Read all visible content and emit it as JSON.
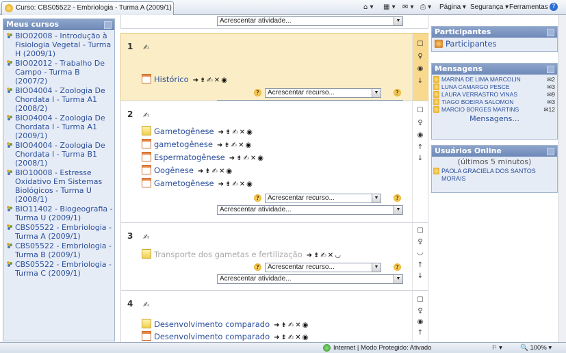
{
  "browser": {
    "tab_title": "Curso: CBS05522 - Embriologia - Turma A (2009/1)",
    "menu": {
      "page": "Página",
      "security": "Segurança",
      "tools": "Ferramentas"
    }
  },
  "left_block": {
    "title": "Meus cursos",
    "courses": [
      "BIO02008 - Introdução à Fisiologia Vegetal - Turma H (2009/1)",
      "BIO02012 - Trabalho De Campo - Turma B (2007/2)",
      "BIO04004 - Zoologia De Chordata I - Turma A1 (2008/2)",
      "BIO04004 - Zoologia De Chordata I - Turma A1 (2009/1)",
      "BIO04004 - Zoologia De Chordata I - Turma B1 (2008/1)",
      "BIO10008 - Estresse Oxidativo Em Sistemas Biológicos - Turma U (2008/1)",
      "BIO11402 - Biogeografia - Turma U (2009/1)",
      "CBS05522 - Embriologia - Turma A (2009/1)",
      "CBS05522 - Embriologia - Turma B (2009/1)",
      "CBS05522 - Embriologia - Turma C (2009/1)"
    ]
  },
  "main": {
    "top_activity_select": "Acrescentar atividade...",
    "add_resource": "Acrescentar recurso...",
    "add_activity": "Acrescentar atividade...",
    "topics": [
      {
        "number": "1",
        "resources": [
          "Histórico"
        ]
      },
      {
        "number": "2",
        "resources": [
          "Gametogênese",
          "gametogênese",
          "Espermatogênese",
          "Oogênese",
          "Gametogênese"
        ]
      },
      {
        "number": "3",
        "resources": [
          "Transporte dos gametas e fertilização"
        ]
      },
      {
        "number": "4",
        "resources": [
          "Desenvolvimento comparado",
          "Desenvolvimento comparado"
        ]
      }
    ]
  },
  "participants_block": {
    "title": "Participantes",
    "link": "Participantes"
  },
  "messages_block": {
    "title": "Mensagens",
    "items": [
      {
        "name": "MARINA DE LIMA MARCOLIN",
        "count": "2"
      },
      {
        "name": "LUNA CAMARGO PESCE",
        "count": "3"
      },
      {
        "name": "LAURA VERRASTRO VINAS",
        "count": "9"
      },
      {
        "name": "TIAGO BOEIRA SALOMON",
        "count": "3"
      },
      {
        "name": "MARCIO BORGES MARTINS",
        "count": "12"
      }
    ],
    "link": "Mensagens..."
  },
  "online_block": {
    "title": "Usuários Online",
    "subtitle": "(últimos 5 minutos)",
    "user": "PAOLA GRACIELA DOS SANTOS MORAIS"
  },
  "status_bar": {
    "zone": "Internet | Modo Protegido: Ativado",
    "zoom": "100%"
  }
}
